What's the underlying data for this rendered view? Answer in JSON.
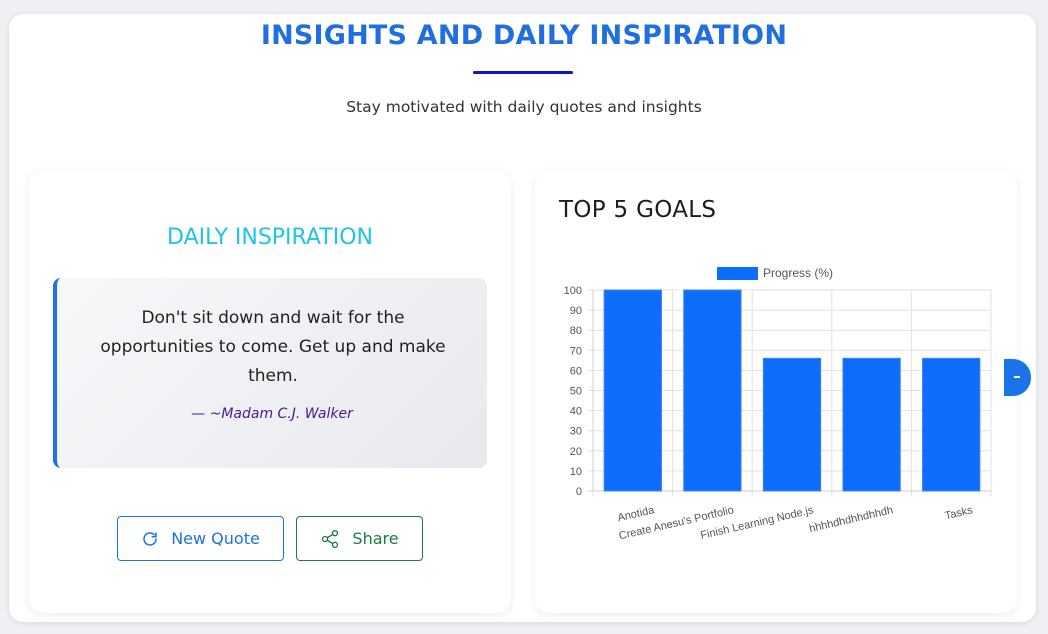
{
  "header": {
    "title": "INSIGHTS AND DAILY INSPIRATION",
    "subtitle": "Stay motivated with daily quotes and insights"
  },
  "inspiration": {
    "title": "DAILY INSPIRATION",
    "quote": "Don't sit down and wait for the opportunities to come. Get up and make them.",
    "author": "— ~Madam C.J. Walker",
    "new_quote_label": "New Quote",
    "new_quote_icon": "refresh-icon",
    "share_label": "Share",
    "share_icon": "share-icon",
    "accent_color": "#1a73e8",
    "share_color": "#1c7a46"
  },
  "goals": {
    "title": "TOP 5 GOALS"
  },
  "chart_data": {
    "type": "bar",
    "categories": [
      "Anotida",
      "Create Anesu's Portfolio",
      "Finish Learning Node.js",
      "hhhhdhdhhdhhdh",
      "Tasks"
    ],
    "series": [
      {
        "name": "Progress (%)",
        "values": [
          100,
          100,
          66,
          66,
          66
        ],
        "color": "#0d6efd"
      }
    ],
    "ylim": [
      0,
      100
    ],
    "yticks": [
      0,
      10,
      20,
      30,
      40,
      50,
      60,
      70,
      80,
      90,
      100
    ],
    "grid": true,
    "legend": "top-center"
  }
}
